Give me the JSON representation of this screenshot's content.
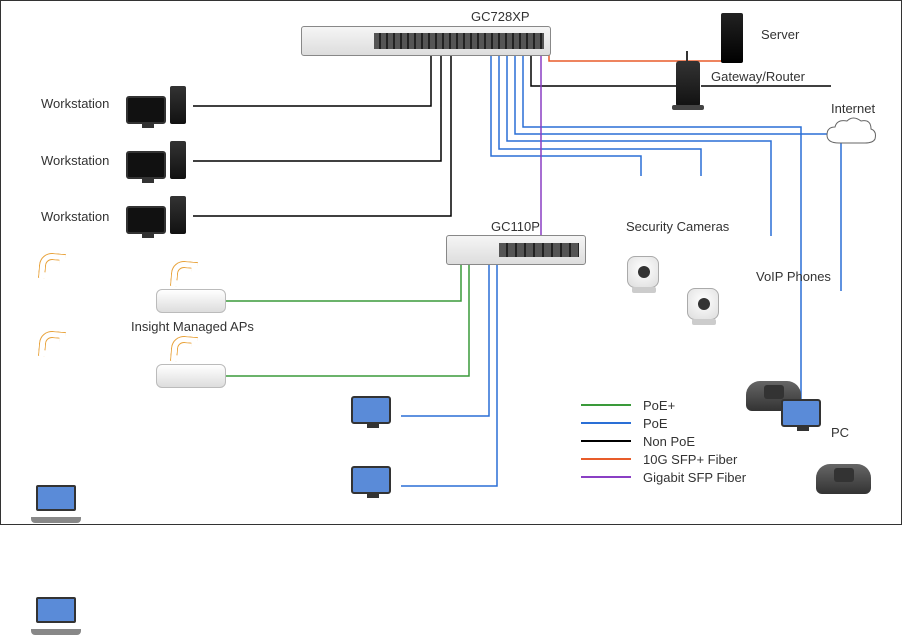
{
  "switches": {
    "main": "GC728XP",
    "secondary": "GC110P"
  },
  "devices": {
    "workstation": "Workstation",
    "server": "Server",
    "gateway": "Gateway/Router",
    "internet": "Internet",
    "cameras": "Security Cameras",
    "voip": "VoIP Phones",
    "aps": "Insight Managed APs",
    "pc": "PC"
  },
  "legend": {
    "poe_plus": {
      "label": "PoE+",
      "color": "#3a9a3a"
    },
    "poe": {
      "label": "PoE",
      "color": "#2a6fd6"
    },
    "non_poe": {
      "label": "Non PoE",
      "color": "#000000"
    },
    "sfp_plus": {
      "label": "10G SFP+ Fiber",
      "color": "#e85c2a"
    },
    "gigabit_sfp": {
      "label": "Gigabit SFP Fiber",
      "color": "#8a3fc4"
    }
  },
  "chart_data": {
    "type": "network-diagram",
    "nodes": [
      {
        "id": "gc728xp",
        "label": "GC728XP",
        "kind": "switch"
      },
      {
        "id": "gc110p",
        "label": "GC110P",
        "kind": "switch"
      },
      {
        "id": "ws1",
        "label": "Workstation",
        "kind": "workstation"
      },
      {
        "id": "ws2",
        "label": "Workstation",
        "kind": "workstation"
      },
      {
        "id": "ws3",
        "label": "Workstation",
        "kind": "workstation"
      },
      {
        "id": "server",
        "label": "Server",
        "kind": "server"
      },
      {
        "id": "gateway",
        "label": "Gateway/Router",
        "kind": "router"
      },
      {
        "id": "internet",
        "label": "Internet",
        "kind": "cloud"
      },
      {
        "id": "cam1",
        "label": "Security Camera",
        "kind": "camera"
      },
      {
        "id": "cam2",
        "label": "Security Camera",
        "kind": "camera"
      },
      {
        "id": "voip1",
        "label": "VoIP Phone",
        "kind": "voip"
      },
      {
        "id": "voip2",
        "label": "VoIP Phone",
        "kind": "voip"
      },
      {
        "id": "ap1",
        "label": "Insight Managed AP",
        "kind": "access-point"
      },
      {
        "id": "ap2",
        "label": "Insight Managed AP",
        "kind": "access-point"
      },
      {
        "id": "laptop1",
        "label": "Laptop",
        "kind": "laptop"
      },
      {
        "id": "laptop2",
        "label": "Laptop",
        "kind": "laptop"
      },
      {
        "id": "pc1",
        "label": "PC",
        "kind": "pc"
      },
      {
        "id": "pc2",
        "label": "PC",
        "kind": "pc"
      },
      {
        "id": "pc3",
        "label": "PC",
        "kind": "pc"
      }
    ],
    "edges": [
      {
        "from": "gc728xp",
        "to": "ws1",
        "link": "Non PoE"
      },
      {
        "from": "gc728xp",
        "to": "ws2",
        "link": "Non PoE"
      },
      {
        "from": "gc728xp",
        "to": "ws3",
        "link": "Non PoE"
      },
      {
        "from": "gc728xp",
        "to": "server",
        "link": "10G SFP+ Fiber"
      },
      {
        "from": "gc728xp",
        "to": "gateway",
        "link": "Non PoE"
      },
      {
        "from": "gateway",
        "to": "internet",
        "link": "Non PoE"
      },
      {
        "from": "gc728xp",
        "to": "cam1",
        "link": "PoE"
      },
      {
        "from": "gc728xp",
        "to": "cam2",
        "link": "PoE"
      },
      {
        "from": "gc728xp",
        "to": "voip1",
        "link": "PoE"
      },
      {
        "from": "gc728xp",
        "to": "voip2",
        "link": "PoE"
      },
      {
        "from": "gc728xp",
        "to": "pc3",
        "link": "PoE"
      },
      {
        "from": "gc728xp",
        "to": "gc110p",
        "link": "Gigabit SFP Fiber"
      },
      {
        "from": "gc110p",
        "to": "ap1",
        "link": "PoE+"
      },
      {
        "from": "gc110p",
        "to": "ap2",
        "link": "PoE+"
      },
      {
        "from": "gc110p",
        "to": "pc1",
        "link": "PoE"
      },
      {
        "from": "gc110p",
        "to": "pc2",
        "link": "PoE"
      },
      {
        "from": "ap1",
        "to": "laptop1",
        "link": "wireless"
      },
      {
        "from": "ap2",
        "to": "laptop2",
        "link": "wireless"
      }
    ],
    "legend": [
      {
        "label": "PoE+",
        "color": "#3a9a3a"
      },
      {
        "label": "PoE",
        "color": "#2a6fd6"
      },
      {
        "label": "Non PoE",
        "color": "#000000"
      },
      {
        "label": "10G SFP+ Fiber",
        "color": "#e85c2a"
      },
      {
        "label": "Gigabit SFP Fiber",
        "color": "#8a3fc4"
      }
    ]
  }
}
